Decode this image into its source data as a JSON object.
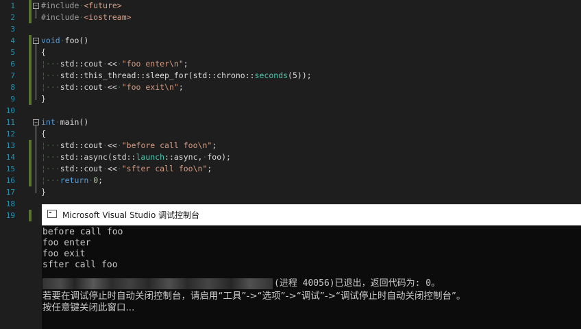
{
  "editor": {
    "line_numbers": [
      "1",
      "2",
      "3",
      "4",
      "5",
      "6",
      "7",
      "8",
      "9",
      "10",
      "11",
      "12",
      "13",
      "14",
      "15",
      "16",
      "17",
      "18",
      "19"
    ],
    "lines": [
      [
        {
          "t": "pre",
          "v": "#include"
        },
        {
          "t": "ws",
          "v": "·"
        },
        {
          "t": "inc",
          "v": "<future>"
        }
      ],
      [
        {
          "t": "pre",
          "v": "#include"
        },
        {
          "t": "ws",
          "v": "·"
        },
        {
          "t": "inc",
          "v": "<iostream>"
        }
      ],
      [],
      [
        {
          "t": "kw",
          "v": "void"
        },
        {
          "t": "ws",
          "v": "·"
        },
        {
          "t": "fn",
          "v": "foo()"
        }
      ],
      [
        {
          "t": "txt",
          "v": "{"
        }
      ],
      [
        {
          "t": "ws",
          "v": "¦···"
        },
        {
          "t": "txt",
          "v": "std::cout"
        },
        {
          "t": "ws",
          "v": "·"
        },
        {
          "t": "txt",
          "v": "<<"
        },
        {
          "t": "ws",
          "v": "·"
        },
        {
          "t": "str",
          "v": "\"foo enter\\n\""
        },
        {
          "t": "txt",
          "v": ";"
        }
      ],
      [
        {
          "t": "ws",
          "v": "¦···"
        },
        {
          "t": "txt",
          "v": "std::this_thread::sleep_for(std::chrono::"
        },
        {
          "t": "type",
          "v": "seconds"
        },
        {
          "t": "txt",
          "v": "(5));"
        }
      ],
      [
        {
          "t": "ws",
          "v": "¦···"
        },
        {
          "t": "txt",
          "v": "std::cout"
        },
        {
          "t": "ws",
          "v": "·"
        },
        {
          "t": "txt",
          "v": "<<"
        },
        {
          "t": "ws",
          "v": "·"
        },
        {
          "t": "str",
          "v": "\"foo exit\\n\""
        },
        {
          "t": "txt",
          "v": ";"
        }
      ],
      [
        {
          "t": "txt",
          "v": "}"
        }
      ],
      [],
      [
        {
          "t": "kw",
          "v": "int"
        },
        {
          "t": "ws",
          "v": "·"
        },
        {
          "t": "fn",
          "v": "main()"
        }
      ],
      [
        {
          "t": "txt",
          "v": "{"
        }
      ],
      [
        {
          "t": "ws",
          "v": "¦···"
        },
        {
          "t": "txt",
          "v": "std::cout"
        },
        {
          "t": "ws",
          "v": "·"
        },
        {
          "t": "txt",
          "v": "<<"
        },
        {
          "t": "ws",
          "v": "·"
        },
        {
          "t": "str",
          "v": "\"before call foo\\n\""
        },
        {
          "t": "txt",
          "v": ";"
        }
      ],
      [
        {
          "t": "ws",
          "v": "¦···"
        },
        {
          "t": "txt",
          "v": "std::async(std::"
        },
        {
          "t": "type",
          "v": "launch"
        },
        {
          "t": "txt",
          "v": "::async,"
        },
        {
          "t": "ws",
          "v": "·"
        },
        {
          "t": "txt",
          "v": "foo);"
        }
      ],
      [
        {
          "t": "ws",
          "v": "¦···"
        },
        {
          "t": "txt",
          "v": "std::cout"
        },
        {
          "t": "ws",
          "v": "·"
        },
        {
          "t": "txt",
          "v": "<<"
        },
        {
          "t": "ws",
          "v": "·"
        },
        {
          "t": "str",
          "v": "\"sfter call foo\\n\""
        },
        {
          "t": "txt",
          "v": ";"
        }
      ],
      [
        {
          "t": "ws",
          "v": "¦···"
        },
        {
          "t": "kw",
          "v": "return"
        },
        {
          "t": "ws",
          "v": "·"
        },
        {
          "t": "num",
          "v": "0"
        },
        {
          "t": "txt",
          "v": ";"
        }
      ],
      [
        {
          "t": "txt",
          "v": "}"
        }
      ],
      [],
      []
    ]
  },
  "console": {
    "title": "Microsoft Visual Studio 调试控制台",
    "output_lines": [
      "before call foo",
      "foo enter",
      "foo exit",
      "sfter call foo"
    ],
    "exit_message": "(进程 40056)已退出，返回代码为: 0。",
    "hint_line": "若要在调试停止时自动关闭控制台，请启用“工具”->“选项”->“调试”->“调试停止时自动关闭控制台”。",
    "press_key_line": "按任意键关闭此窗口..."
  },
  "colors": {
    "editor_bg": "#1e1e1e",
    "line_number": "#2b91af",
    "keyword": "#569cd6",
    "string": "#d69d85",
    "type": "#4ec9b0",
    "console_bg": "#0c0c0c",
    "console_text": "#cccccc"
  }
}
